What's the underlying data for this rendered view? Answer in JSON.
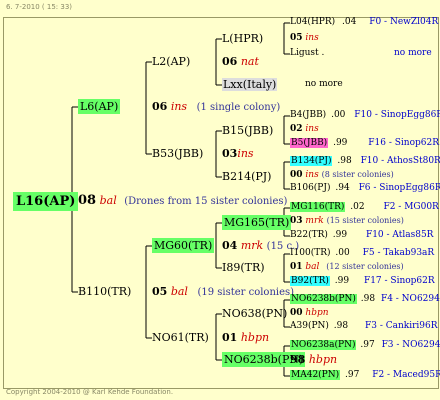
{
  "header": "6.  7-2010 ( 15: 33)",
  "footer": "Copyright 2004-2010 @ Karl Kehde Foundation.",
  "root": {
    "label": "L16(AP)",
    "num": "08",
    "code": "bal",
    "note": "(Drones from 15 sister colonies)"
  },
  "gen1": [
    {
      "label": "L6(AP)",
      "num": "06",
      "code": "ins",
      "note": "(1 single colony)"
    },
    {
      "label": "B110(TR)",
      "num": "05",
      "code": "bal",
      "note": "(19 sister colonies)"
    }
  ],
  "gen2": [
    {
      "label": "L2(AP)"
    },
    {
      "label": "B53(JBB)",
      "num": "03",
      "code": "ins"
    },
    {
      "label": "MG60(TR)",
      "num": "04",
      "code": "mrk",
      "note": "(15 c.)"
    },
    {
      "label": "NO61(TR)",
      "num": "01",
      "code": "hbpn"
    }
  ],
  "gen3": [
    {
      "label": "L(HPR)"
    },
    {
      "label": "06",
      "code": "nat"
    },
    {
      "label": "Lxx(Italy)"
    },
    {
      "label": "B15(JBB)"
    },
    {
      "label": "B214(PJ)"
    },
    {
      "label": "MG165(TR)"
    },
    {
      "label": "I89(TR)"
    },
    {
      "label": "NO638(PN)"
    },
    {
      "label": "NO6238b(PN)"
    },
    {
      "label": "98",
      "code": "hbpn"
    }
  ],
  "gen4": [
    {
      "label": "L04(HPR)",
      "val": ".04",
      "info": "F0 - NewZl04R"
    },
    {
      "label": "05",
      "code": "ins"
    },
    {
      "label": "Ligust .",
      "info": "no more"
    },
    {
      "label": "no more"
    },
    {
      "label": "B4(JBB)",
      "val": ".00",
      "info": "F10 - SinopEgg86R"
    },
    {
      "label": "02",
      "code": "ins"
    },
    {
      "label": "B5(JBB)",
      "val": ".99",
      "info": "F16 - Sinop62R"
    },
    {
      "label": "B134(PJ)",
      "val": ".98",
      "info": "F10 - AthosSt80R"
    },
    {
      "label": "00",
      "code": "ins",
      "note": "(8 sister colonies)"
    },
    {
      "label": "B106(PJ)",
      "val": ".94",
      "info": "F6 - SinopEgg86R"
    },
    {
      "label": "MG116(TR)",
      "val": ".02",
      "info": "F2 - MG00R"
    },
    {
      "label": "03",
      "code": "mrk",
      "note": "(15 sister colonies)"
    },
    {
      "label": "B22(TR)",
      "val": ".99",
      "info": "F10 - Atlas85R"
    },
    {
      "label": "I100(TR)",
      "val": ".00",
      "info": "F5 - Takab93aR"
    },
    {
      "label": "01",
      "code": "bal",
      "note": "(12 sister colonies)"
    },
    {
      "label": "B92(TR)",
      "val": ".99",
      "info": "F17 - Sinop62R"
    },
    {
      "label": "NO6238b(PN)",
      "val": ".98",
      "info": "F4 - NO6294R"
    },
    {
      "label": "00",
      "code": "hbpn"
    },
    {
      "label": "A39(PN)",
      "val": ".98",
      "info": "F3 - Cankiri96R"
    },
    {
      "label": "NO6238a(PN)",
      "val": ".97",
      "info": "F3 - NO6294R"
    },
    {
      "label": "MA42(PN)",
      "val": ".97",
      "info": "F2 - Maced95R"
    }
  ]
}
